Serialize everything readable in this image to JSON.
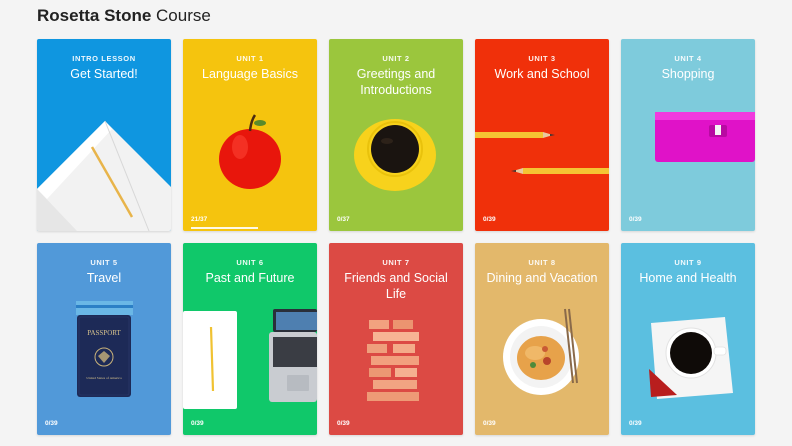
{
  "header": {
    "brand": "Rosetta Stone",
    "suffix": "Course"
  },
  "cards": [
    {
      "kicker": "INTRO LESSON",
      "title": "Get Started!",
      "progress": "",
      "color": "#0f96e0",
      "image": "open-notebook-icon"
    },
    {
      "kicker": "UNIT 1",
      "title": "Language Basics",
      "progress": "21/37",
      "progress_fraction": 0.57,
      "color": "#f5c40e",
      "image": "red-apple-icon"
    },
    {
      "kicker": "UNIT 2",
      "title": "Greetings and Introductions",
      "progress": "0/37",
      "color": "#9bc63d",
      "image": "coffee-cup-icon"
    },
    {
      "kicker": "UNIT 3",
      "title": "Work and School",
      "progress": "0/39",
      "color": "#f0300a",
      "image": "pencils-icon"
    },
    {
      "kicker": "UNIT 4",
      "title": "Shopping",
      "progress": "0/39",
      "color": "#7ecbdc",
      "image": "wallet-icon"
    },
    {
      "kicker": "UNIT 5",
      "title": "Travel",
      "progress": "0/39",
      "color": "#5199d9",
      "image": "passport-icon",
      "passport_text": "PASSPORT",
      "passport_subtext": "United States of America"
    },
    {
      "kicker": "UNIT 6",
      "title": "Past and Future",
      "progress": "0/39",
      "color": "#10c86a",
      "image": "notebook-laptop-icon"
    },
    {
      "kicker": "UNIT 7",
      "title": "Friends and Social Life",
      "progress": "0/39",
      "color": "#dc4a44",
      "image": "block-tower-icon"
    },
    {
      "kicker": "UNIT 8",
      "title": "Dining and Vacation",
      "progress": "0/39",
      "color": "#e3b86b",
      "image": "noodle-plate-icon"
    },
    {
      "kicker": "UNIT 9",
      "title": "Home and Health",
      "progress": "0/39",
      "color": "#5bbfe0",
      "image": "coffee-saucer-icon"
    }
  ]
}
